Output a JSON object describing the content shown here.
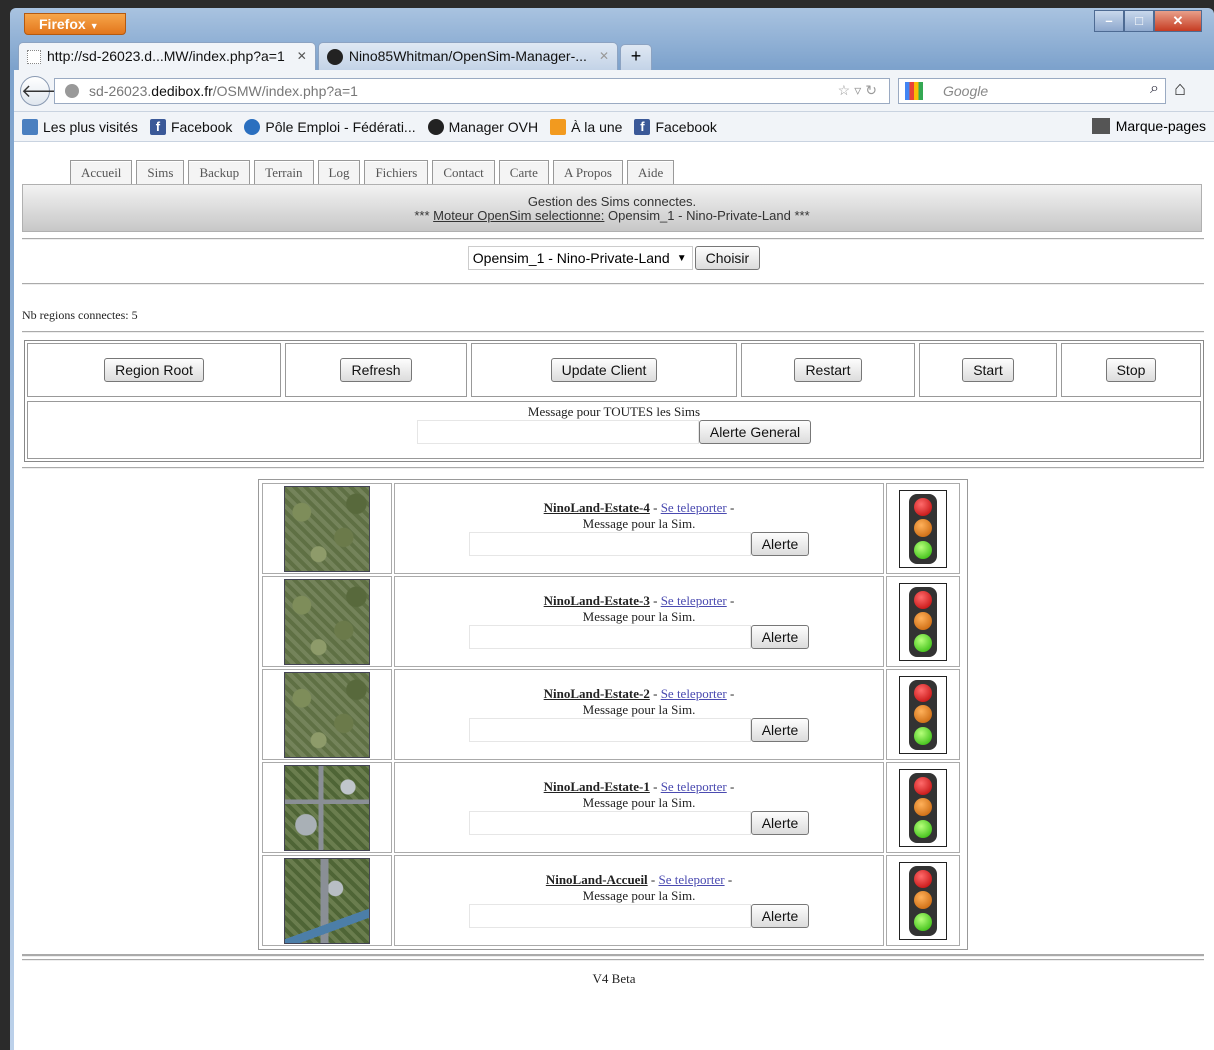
{
  "browser": {
    "menu_label": "Firefox",
    "tabs": [
      {
        "label": "http://sd-26023.d...MW/index.php?a=1"
      },
      {
        "label": "Nino85Whitman/OpenSim-Manager-..."
      }
    ],
    "new_tab_label": "+",
    "url_prefix": "sd-26023.",
    "url_domain": "dedibox.fr",
    "url_path": "/OSMW/index.php?a=1",
    "search_placeholder": "Google",
    "bookmarks": [
      {
        "label": "Les plus visités",
        "icon": "most-visited-icon"
      },
      {
        "label": "Facebook",
        "icon": "facebook-icon"
      },
      {
        "label": "Pôle Emploi - Fédérati...",
        "icon": "pole-emploi-icon"
      },
      {
        "label": "Manager OVH",
        "icon": "ovh-icon"
      },
      {
        "label": "À la une",
        "icon": "rss-icon"
      },
      {
        "label": "Facebook",
        "icon": "facebook-icon"
      }
    ],
    "bookmarks_menu_label": "Marque-pages"
  },
  "menu": [
    "Accueil",
    "Sims",
    "Backup",
    "Terrain",
    "Log",
    "Fichiers",
    "Contact",
    "Carte",
    "A Propos",
    "Aide"
  ],
  "header": {
    "title": "Gestion des Sims connectes.",
    "engine_prefix": "***",
    "engine_label": "Moteur OpenSim selectionne:",
    "engine_value": "Opensim_1 - Nino-Private-Land",
    "engine_suffix": "***"
  },
  "selector": {
    "selected": "Opensim_1 - Nino-Private-Land",
    "button": "Choisir"
  },
  "nb_regions_text": "Nb regions connectes: 5",
  "actions": [
    "Region Root",
    "Refresh",
    "Update Client",
    "Restart",
    "Start",
    "Stop"
  ],
  "global_message": {
    "label": "Message pour TOUTES les Sims",
    "value": "",
    "button": "Alerte General"
  },
  "sims": [
    {
      "name": "NinoLand-Estate-4",
      "teleport": "Se teleporter",
      "msg_label": "Message pour la Sim.",
      "button": "Alerte",
      "status": "running"
    },
    {
      "name": "NinoLand-Estate-3",
      "teleport": "Se teleporter",
      "msg_label": "Message pour la Sim.",
      "button": "Alerte",
      "status": "running"
    },
    {
      "name": "NinoLand-Estate-2",
      "teleport": "Se teleporter",
      "msg_label": "Message pour la Sim.",
      "button": "Alerte",
      "status": "running"
    },
    {
      "name": "NinoLand-Estate-1",
      "teleport": "Se teleporter",
      "msg_label": "Message pour la Sim.",
      "button": "Alerte",
      "status": "running"
    },
    {
      "name": "NinoLand-Accueil",
      "teleport": "Se teleporter",
      "msg_label": "Message pour la Sim.",
      "button": "Alerte",
      "status": "running"
    }
  ],
  "footer": "V4 Beta"
}
